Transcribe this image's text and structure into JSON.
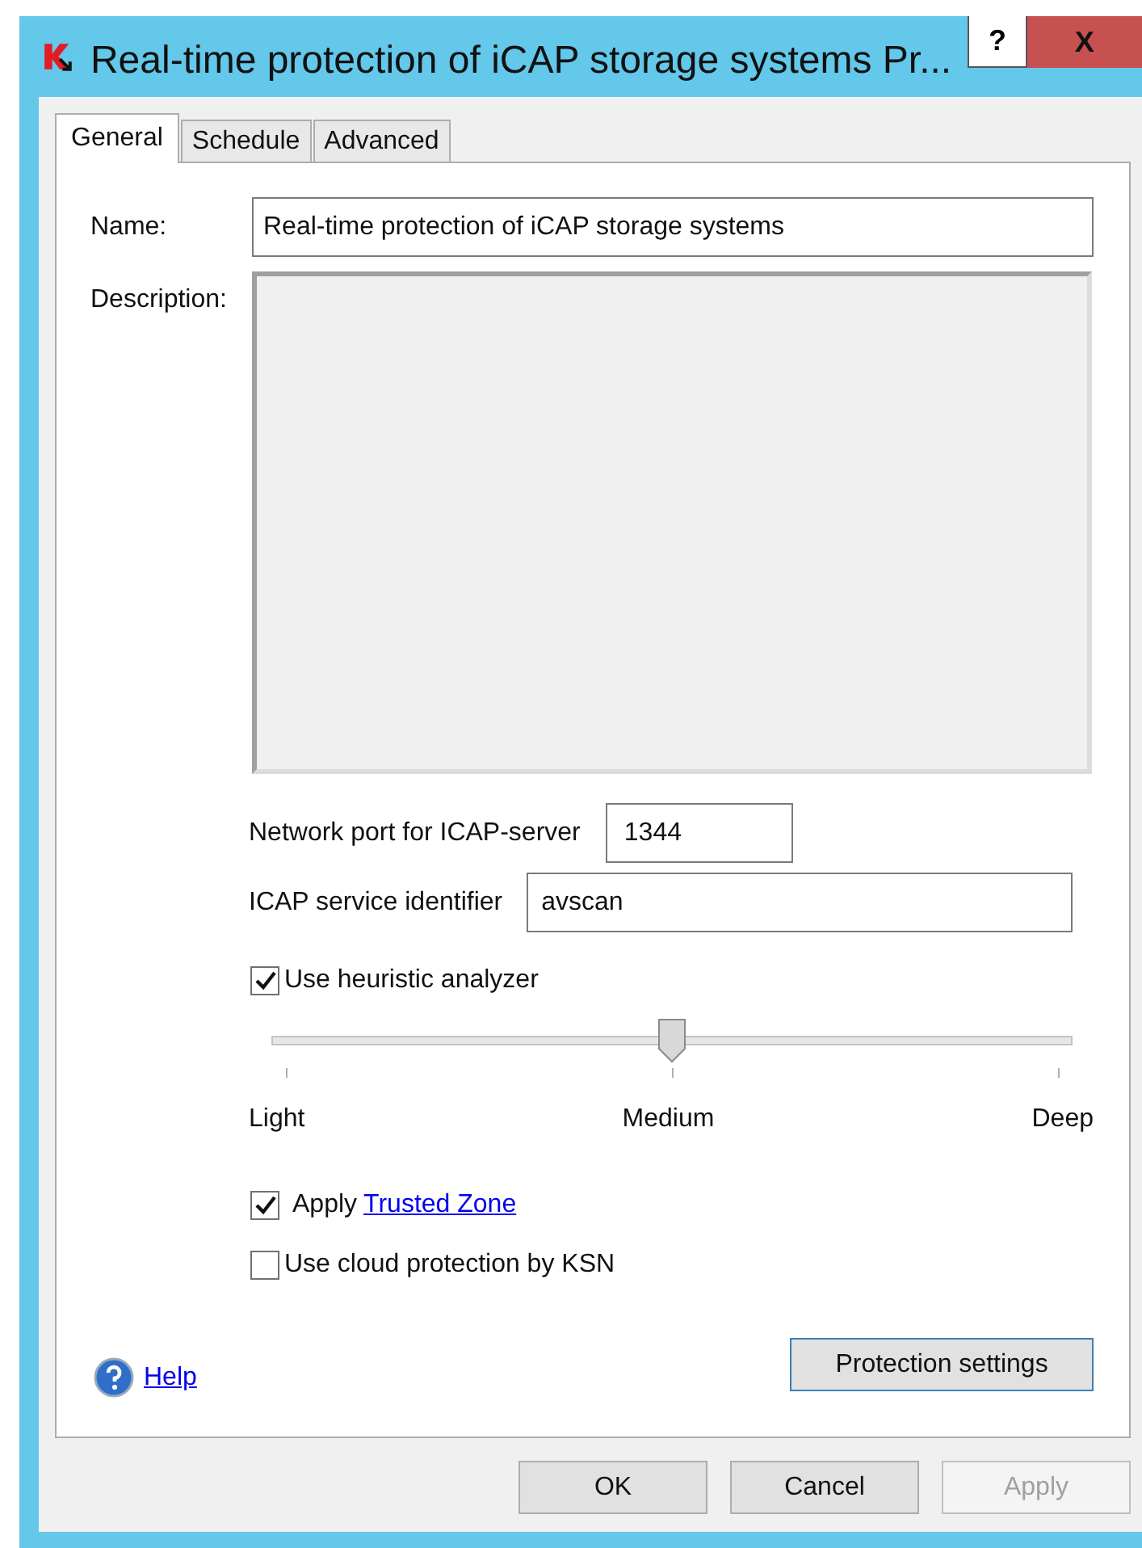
{
  "window": {
    "title": "Real-time protection of iCAP storage systems Pr...",
    "help_glyph": "?",
    "close_glyph": "X"
  },
  "tabs": [
    {
      "label": "General",
      "selected": true
    },
    {
      "label": "Schedule",
      "selected": false
    },
    {
      "label": "Advanced",
      "selected": false
    }
  ],
  "name": {
    "label": "Name:",
    "value": "Real-time protection of iCAP storage systems"
  },
  "description": {
    "label": "Description:",
    "disabled": true
  },
  "port": {
    "label": "Network port for ICAP-server",
    "value": "1344"
  },
  "service": {
    "label": "ICAP service identifier",
    "value": "avscan"
  },
  "heuristic": {
    "label": "Use heuristic analyzer",
    "checked": true
  },
  "slider": {
    "level": 0.5,
    "stops": [
      "Light",
      "Medium",
      "Deep"
    ]
  },
  "trusted_zone": {
    "label": "Apply",
    "link": "Trusted Zone",
    "checked": true
  },
  "ksn": {
    "label": "Use cloud protection by KSN",
    "checked": false
  },
  "help": {
    "label": "Help"
  },
  "protection_button": {
    "label": "Protection settings"
  },
  "buttons": [
    {
      "label": "OK",
      "disabled": false
    },
    {
      "label": "Cancel",
      "disabled": false
    },
    {
      "label": "Apply",
      "disabled": true
    }
  ]
}
